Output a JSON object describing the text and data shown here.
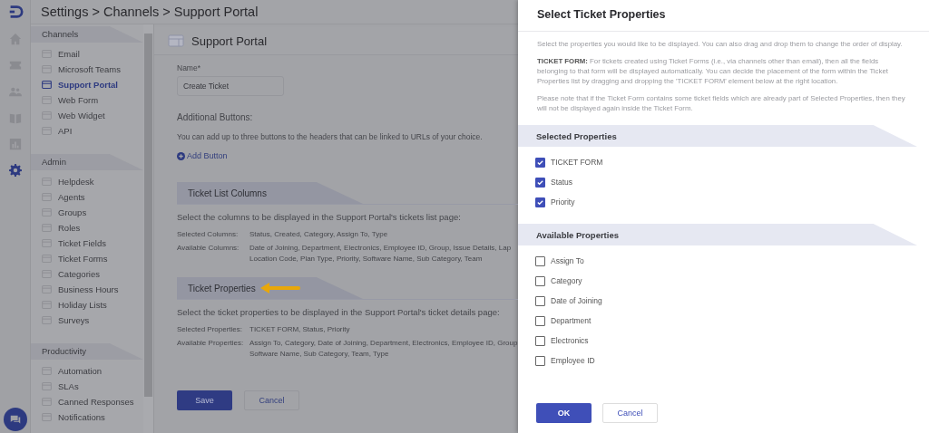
{
  "breadcrumb": "Settings > Channels > Support Portal",
  "rail": [
    {
      "kind": "home",
      "selected": false
    },
    {
      "kind": "tickets",
      "selected": false
    },
    {
      "kind": "contacts",
      "selected": false
    },
    {
      "kind": "knowledge",
      "selected": false
    },
    {
      "kind": "reports",
      "selected": false
    },
    {
      "kind": "settings",
      "selected": true
    }
  ],
  "sidebar": [
    {
      "title": "Channels",
      "items": [
        {
          "label": "Email",
          "selected": false
        },
        {
          "label": "Microsoft Teams",
          "selected": false
        },
        {
          "label": "Support Portal",
          "selected": true
        },
        {
          "label": "Web Form",
          "selected": false
        },
        {
          "label": "Web Widget",
          "selected": false
        },
        {
          "label": "API",
          "selected": false
        }
      ]
    },
    {
      "title": "Admin",
      "items": [
        {
          "label": "Helpdesk",
          "selected": false
        },
        {
          "label": "Agents",
          "selected": false
        },
        {
          "label": "Groups",
          "selected": false
        },
        {
          "label": "Roles",
          "selected": false
        },
        {
          "label": "Ticket Fields",
          "selected": false
        },
        {
          "label": "Ticket Forms",
          "selected": false
        },
        {
          "label": "Categories",
          "selected": false
        },
        {
          "label": "Business Hours",
          "selected": false
        },
        {
          "label": "Holiday Lists",
          "selected": false
        },
        {
          "label": "Surveys",
          "selected": false
        }
      ]
    },
    {
      "title": "Productivity",
      "items": [
        {
          "label": "Automation",
          "selected": false
        },
        {
          "label": "SLAs",
          "selected": false
        },
        {
          "label": "Canned Responses",
          "selected": false
        },
        {
          "label": "Notifications",
          "selected": false
        }
      ]
    }
  ],
  "page": {
    "title": "Support Portal",
    "name_label": "Name*",
    "name_value": "Create Ticket",
    "additional_title": "Additional Buttons:",
    "additional_text": "You can add up to three buttons to the headers that can be linked to URLs of your choice.",
    "add_button": "Add Button",
    "sections": [
      {
        "title": "Ticket List Columns",
        "arrow": false,
        "text": "Select the columns to be displayed in the Support Portal's tickets list page:",
        "rows": [
          {
            "label": "Selected Columns:",
            "value": "Status, Created, Category, Assign To, Type"
          },
          {
            "label": "Available Columns:",
            "value": "Date of Joining, Department, Electronics, Employee ID, Group, Issue Details, Lap Location Code, Plan Type, Priority, Software Name, Sub Category, Team"
          }
        ]
      },
      {
        "title": "Ticket Properties",
        "arrow": true,
        "text": "Select the ticket properties to be displayed in the Support Portal's ticket details page:",
        "rows": [
          {
            "label": "Selected Properties:",
            "value": "TICKET FORM, Status, Priority"
          },
          {
            "label": "Available Properties:",
            "value": "Assign To, Category, Date of Joining, Department, Electronics, Employee ID, Group Software Name, Sub Category, Team, Type"
          }
        ]
      }
    ],
    "save": "Save",
    "cancel": "Cancel"
  },
  "drawer": {
    "title": "Select Ticket Properties",
    "paragraphs": [
      "Select the properties you would like to be displayed. You can also drag and drop them to change the order of display.",
      "**TICKET FORM:** For tickets created using Ticket Forms (i.e., via channels other than email), then all the fields belonging to that form will be displayed automatically. You can decide the placement of the form within the Ticket Properties list by dragging and dropping the 'TICKET FORM' element below at the right location.",
      "Please note that if the Ticket Form contains some ticket fields which are already part of Selected Properties, then they will not be displayed again inside the Ticket Form."
    ],
    "groups": [
      {
        "title": "Selected Properties",
        "items": [
          {
            "label": "TICKET FORM",
            "checked": true
          },
          {
            "label": "Status",
            "checked": true
          },
          {
            "label": "Priority",
            "checked": true
          }
        ]
      },
      {
        "title": "Available Properties",
        "items": [
          {
            "label": "Assign To",
            "checked": false
          },
          {
            "label": "Category",
            "checked": false
          },
          {
            "label": "Date of Joining",
            "checked": false
          },
          {
            "label": "Department",
            "checked": false
          },
          {
            "label": "Electronics",
            "checked": false
          },
          {
            "label": "Employee ID",
            "checked": false
          }
        ]
      }
    ],
    "ok": "OK",
    "cancel": "Cancel"
  }
}
